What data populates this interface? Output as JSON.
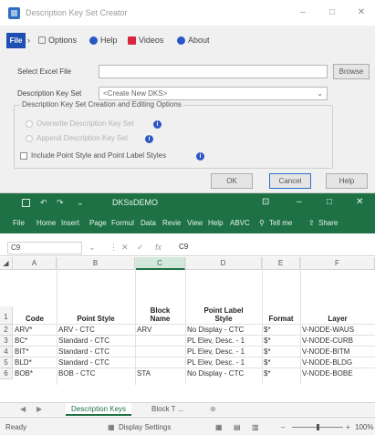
{
  "dialog": {
    "title": "Description Key Set Creator",
    "menu": {
      "file": "File",
      "options": "Options",
      "help": "Help",
      "videos": "Videos",
      "about": "About"
    },
    "select_excel_label": "Select Excel File",
    "excel_file_value": "",
    "browse_label": "Browse",
    "desc_key_set_label": "Description Key Set",
    "desc_key_set_value": "<Create New DKS>",
    "group_title": "Description Key Set Creation and Editing Options",
    "radio_overwrite": "Overwrite Description Key Set",
    "radio_append": "Append Description Key Set",
    "checkbox_label": "Include Point Style and Point Label Styles",
    "ok_label": "OK",
    "cancel_label": "Cancel",
    "help_label": "Help"
  },
  "excel": {
    "file_name": "DKSsDEMO",
    "window_controls": {
      "minimize": "–",
      "restore": "□",
      "close": "✕",
      "ribbon_display": "⊡"
    },
    "ribbon_tabs": [
      "File",
      "Home",
      "Insert",
      "Page",
      "Formul",
      "Data",
      "Revie",
      "View",
      "Help",
      "ABVC"
    ],
    "tell_me": "Tell me",
    "share": "Share",
    "name_box": "C9",
    "formula_value": "C9",
    "columns": [
      {
        "letter": "A",
        "selected": false
      },
      {
        "letter": "B",
        "selected": false
      },
      {
        "letter": "C",
        "selected": true
      },
      {
        "letter": "D",
        "selected": false
      },
      {
        "letter": "E",
        "selected": false
      },
      {
        "letter": "F",
        "selected": false
      }
    ],
    "header_row": {
      "number": "1",
      "cells": [
        "Code",
        "Point Style",
        "Block Name",
        "Point Label Style",
        "Format",
        "Layer"
      ]
    },
    "rows": [
      {
        "number": "2",
        "cells": [
          "ARV*",
          "ARV - CTC",
          "ARV",
          "No Display - CTC",
          "$*",
          "V-NODE-WAUS"
        ]
      },
      {
        "number": "3",
        "cells": [
          "BC*",
          "Standard - CTC",
          "",
          "PL Elev, Desc. - 1",
          "$*",
          "V-NODE-CURB"
        ]
      },
      {
        "number": "4",
        "cells": [
          "BIT*",
          "Standard - CTC",
          "",
          "PL Elev, Desc. - 1",
          "$*",
          "V-NODE-BITM"
        ]
      },
      {
        "number": "5",
        "cells": [
          "BLD*",
          "Standard - CTC",
          "",
          "PL Elev, Desc. - 1",
          "$*",
          "V-NODE-BLDG"
        ]
      },
      {
        "number": "6",
        "cells": [
          "BOB*",
          "BOB - CTC",
          "STA",
          "No Display - CTC",
          "$*",
          "V-NODE-BOBE"
        ]
      }
    ],
    "sheet_tabs": [
      "Description Keys",
      "Block T ..."
    ],
    "status_ready": "Ready",
    "status_display": "Display Settings",
    "zoom": "100%"
  }
}
